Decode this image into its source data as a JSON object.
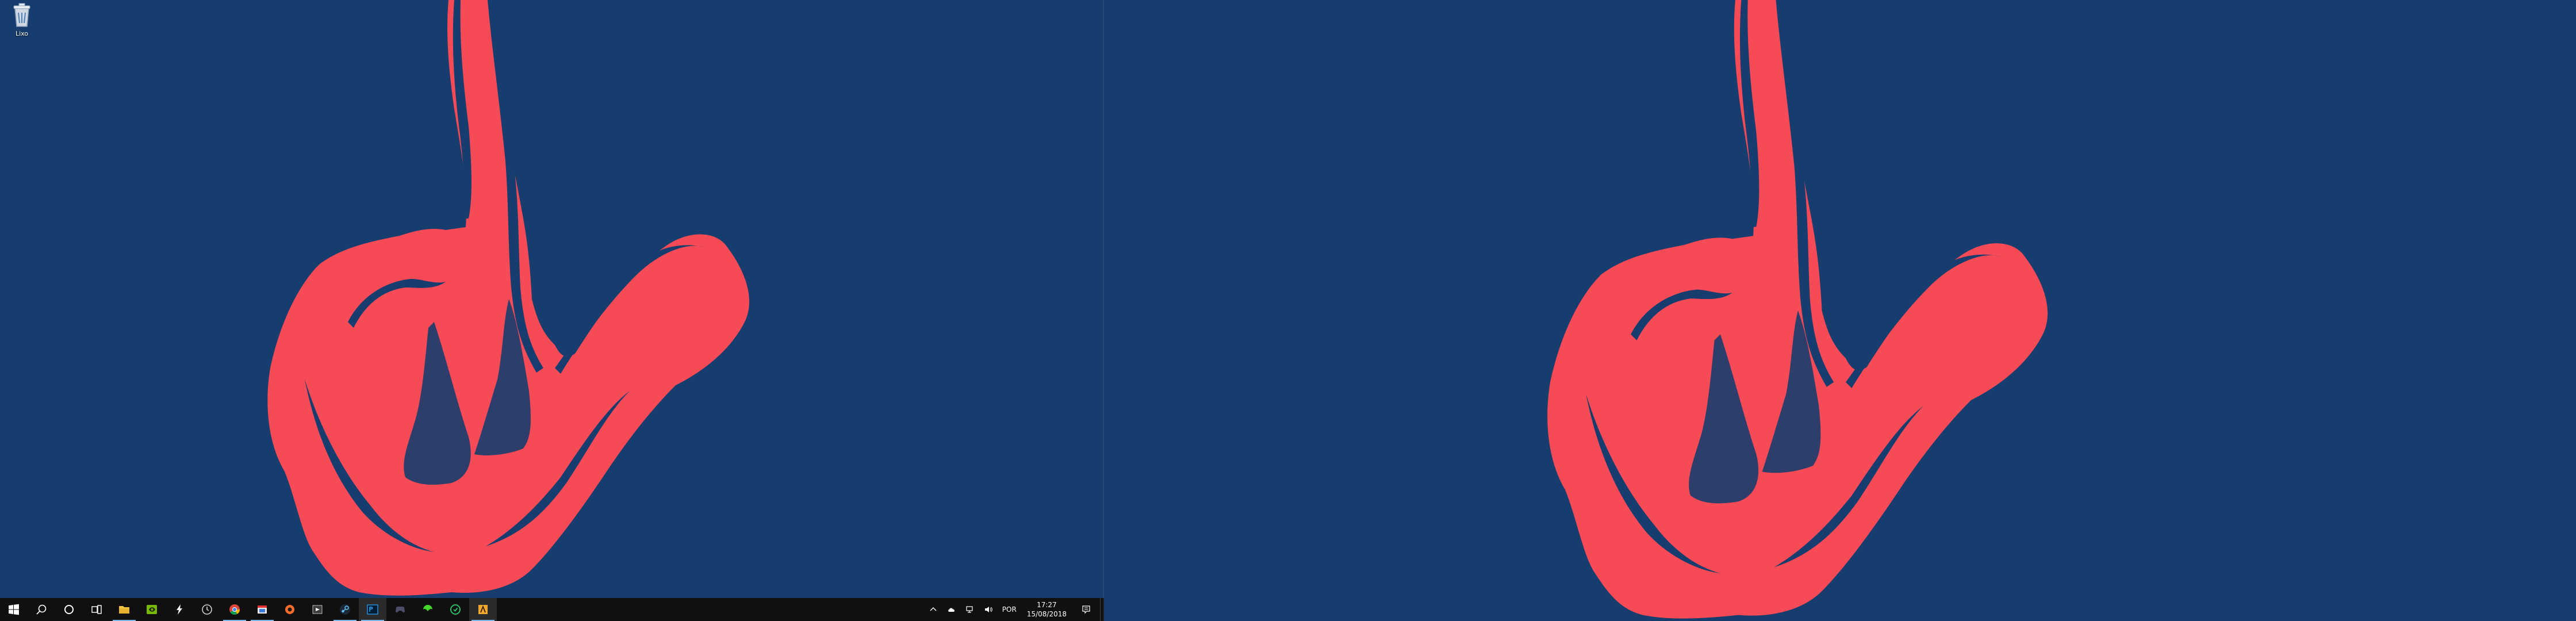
{
  "desktop": {
    "background_color": "#173d6e",
    "wallpaper_color": "#f64a56",
    "icons": [
      {
        "label": "Lixo",
        "icon": "recycle-bin-icon"
      }
    ]
  },
  "taskbar": {
    "buttons": [
      {
        "name": "start-button",
        "icon": "windows-logo-icon"
      },
      {
        "name": "search-button",
        "icon": "search-icon"
      },
      {
        "name": "cortana-button",
        "icon": "cortana-circle-icon"
      },
      {
        "name": "task-view-button",
        "icon": "task-view-icon"
      },
      {
        "name": "taskbar-app-file-explorer",
        "icon": "folder-icon"
      },
      {
        "name": "taskbar-app-nvidia",
        "icon": "nvidia-icon"
      },
      {
        "name": "taskbar-app-flash",
        "icon": "lightning-icon"
      },
      {
        "name": "taskbar-app-clock",
        "icon": "clock-circle-icon"
      },
      {
        "name": "taskbar-app-chrome",
        "icon": "chrome-icon"
      },
      {
        "name": "taskbar-app-window",
        "icon": "window-red-icon"
      },
      {
        "name": "taskbar-app-origin",
        "icon": "orange-circle-icon"
      },
      {
        "name": "taskbar-app-media",
        "icon": "media-icon"
      },
      {
        "name": "taskbar-app-steam",
        "icon": "steam-icon"
      },
      {
        "name": "taskbar-app-photoshop",
        "icon": "photoshop-icon"
      },
      {
        "name": "taskbar-app-controller",
        "icon": "gamepad-icon"
      },
      {
        "name": "taskbar-app-razer",
        "icon": "razer-icon"
      },
      {
        "name": "taskbar-app-green",
        "icon": "green-circle-icon"
      },
      {
        "name": "taskbar-app-game",
        "icon": "game-icon"
      }
    ],
    "tray": {
      "language": "POR",
      "time": "17:27",
      "date": "15/08/2018"
    }
  }
}
